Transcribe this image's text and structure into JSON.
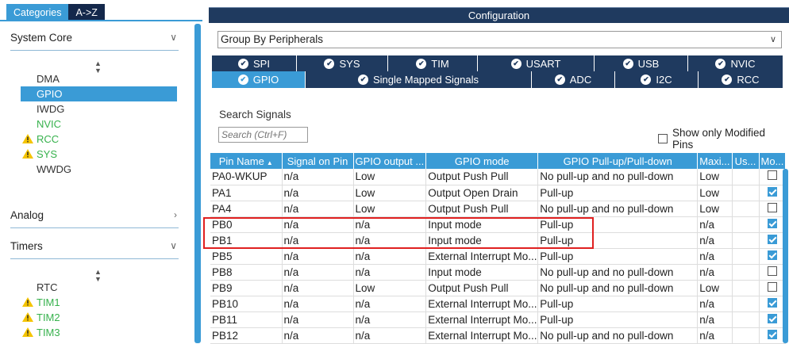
{
  "left_panel": {
    "tabs": [
      {
        "label": "Categories",
        "active": true
      },
      {
        "label": "A->Z",
        "active": false
      }
    ],
    "sections": {
      "system_core": {
        "label": "System Core"
      },
      "analog": {
        "label": "Analog"
      },
      "timers": {
        "label": "Timers"
      }
    },
    "system_core_items": [
      {
        "label": "DMA"
      },
      {
        "label": "GPIO"
      },
      {
        "label": "IWDG"
      },
      {
        "label": "NVIC"
      },
      {
        "label": "RCC"
      },
      {
        "label": "SYS"
      },
      {
        "label": "WWDG"
      }
    ],
    "timer_items": [
      {
        "label": "RTC"
      },
      {
        "label": "TIM1"
      },
      {
        "label": "TIM2"
      },
      {
        "label": "TIM3"
      }
    ]
  },
  "config": {
    "title": "Configuration",
    "group_by": "Group By Peripherals",
    "tabs_row1": [
      "SPI",
      "SYS",
      "TIM",
      "USART",
      "USB",
      "NVIC"
    ],
    "tabs_row2": [
      "GPIO",
      "Single Mapped Signals",
      "ADC",
      "I2C",
      "RCC"
    ],
    "search_label": "Search Signals",
    "search_placeholder": "Search (Ctrl+F)",
    "show_modified_label": "Show only Modified Pins"
  },
  "table": {
    "headers": [
      "Pin Name",
      "Signal on Pin",
      "GPIO output ...",
      "GPIO mode",
      "GPIO Pull-up/Pull-down",
      "Maxi...",
      "Us...",
      "Mo..."
    ],
    "rows": [
      {
        "pin": "PA0-WKUP",
        "signal": "n/a",
        "output": "Low",
        "mode": "Output Push Pull",
        "pull": "No pull-up and no pull-down",
        "max": "Low",
        "user": "",
        "modified": false
      },
      {
        "pin": "PA1",
        "signal": "n/a",
        "output": "Low",
        "mode": "Output Open Drain",
        "pull": "Pull-up",
        "max": "Low",
        "user": "",
        "modified": true
      },
      {
        "pin": "PA4",
        "signal": "n/a",
        "output": "Low",
        "mode": "Output Push Pull",
        "pull": "No pull-up and no pull-down",
        "max": "Low",
        "user": "",
        "modified": false
      },
      {
        "pin": "PB0",
        "signal": "n/a",
        "output": "n/a",
        "mode": "Input mode",
        "pull": "Pull-up",
        "max": "n/a",
        "user": "",
        "modified": true
      },
      {
        "pin": "PB1",
        "signal": "n/a",
        "output": "n/a",
        "mode": "Input mode",
        "pull": "Pull-up",
        "max": "n/a",
        "user": "",
        "modified": true
      },
      {
        "pin": "PB5",
        "signal": "n/a",
        "output": "n/a",
        "mode": "External Interrupt Mo...",
        "pull": "Pull-up",
        "max": "n/a",
        "user": "",
        "modified": true
      },
      {
        "pin": "PB8",
        "signal": "n/a",
        "output": "n/a",
        "mode": "Input mode",
        "pull": "No pull-up and no pull-down",
        "max": "n/a",
        "user": "",
        "modified": false
      },
      {
        "pin": "PB9",
        "signal": "n/a",
        "output": "Low",
        "mode": "Output Push Pull",
        "pull": "No pull-up and no pull-down",
        "max": "Low",
        "user": "",
        "modified": false
      },
      {
        "pin": "PB10",
        "signal": "n/a",
        "output": "n/a",
        "mode": "External Interrupt Mo...",
        "pull": "Pull-up",
        "max": "n/a",
        "user": "",
        "modified": true
      },
      {
        "pin": "PB11",
        "signal": "n/a",
        "output": "n/a",
        "mode": "External Interrupt Mo...",
        "pull": "Pull-up",
        "max": "n/a",
        "user": "",
        "modified": true
      },
      {
        "pin": "PB12",
        "signal": "n/a",
        "output": "n/a",
        "mode": "External Interrupt Mo...",
        "pull": "No pull-up and no pull-down",
        "max": "n/a",
        "user": "",
        "modified": true
      }
    ]
  },
  "colors": {
    "accent": "#3a9bd6",
    "dark": "#1f3a5f",
    "ok": "#37b24d",
    "warning": "#f5c400",
    "highlight": "#e02020"
  }
}
